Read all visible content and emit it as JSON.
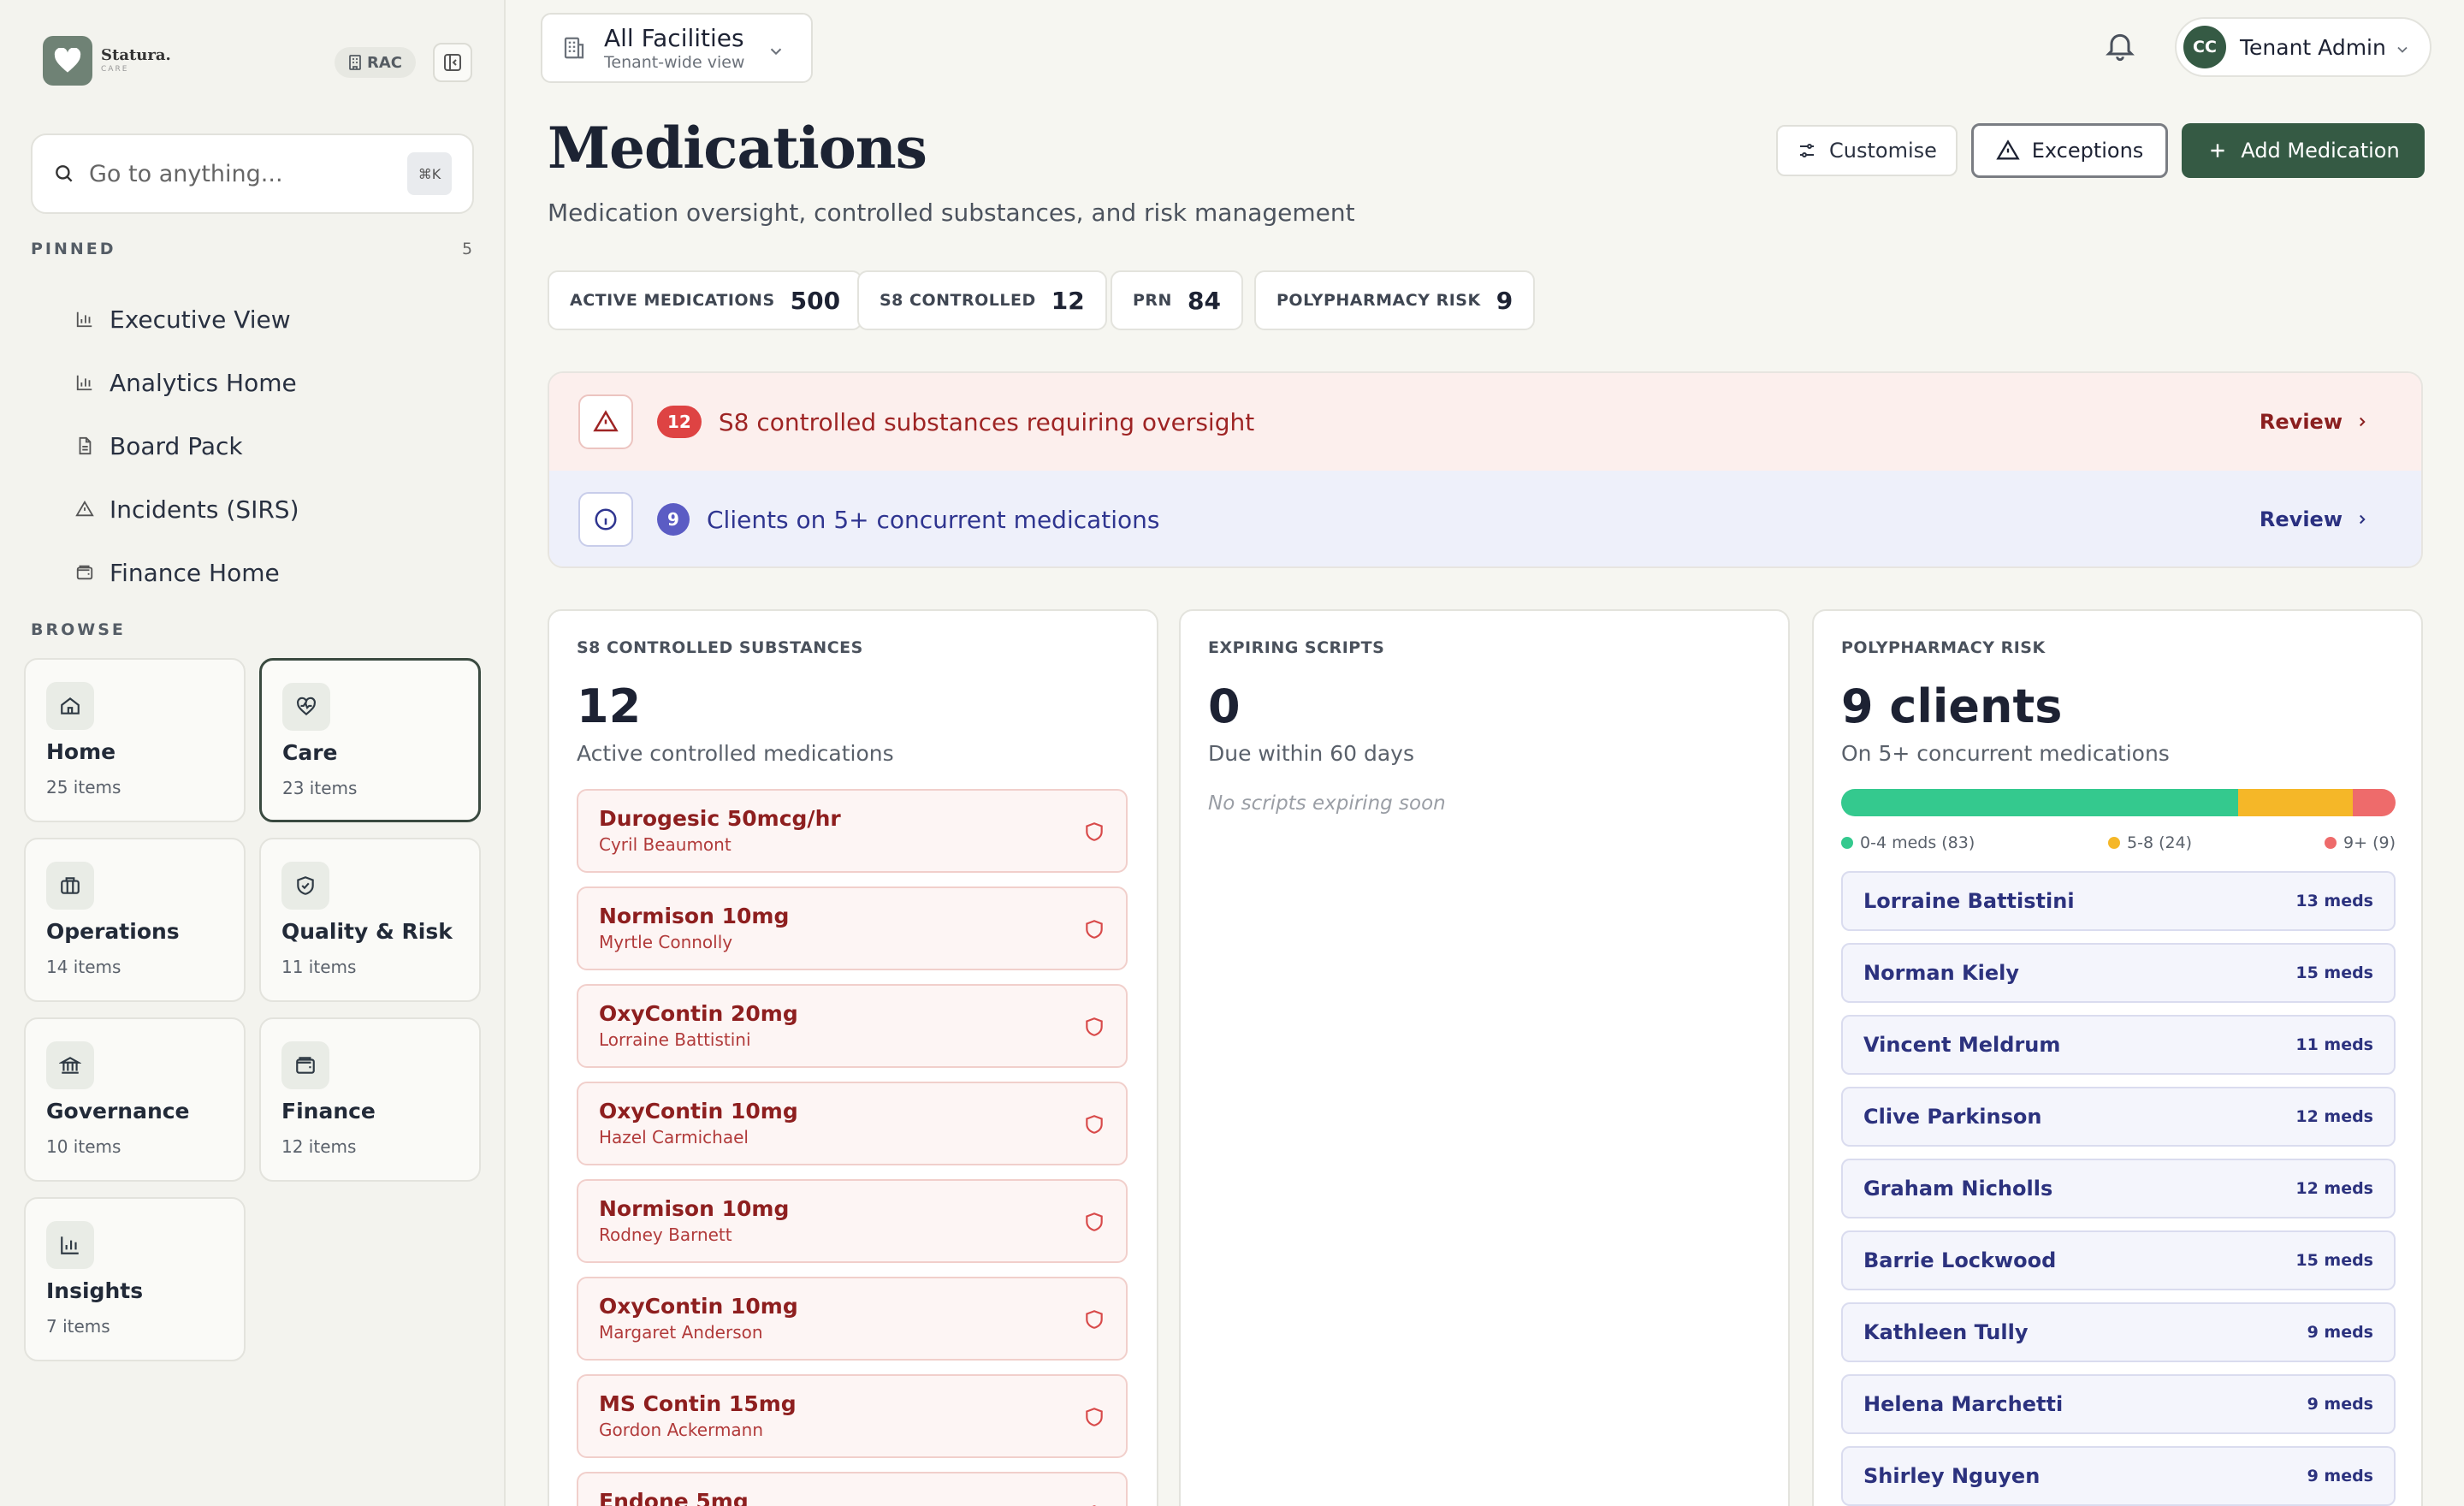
{
  "brand": {
    "name": "Statura.",
    "sub": "CARE"
  },
  "org_badge": "RAC",
  "search": {
    "placeholder": "Go to anything...",
    "shortcut": "⌘K"
  },
  "pinned": {
    "label": "PINNED",
    "count": "5",
    "items": [
      {
        "label": "Executive View",
        "icon": "bar-chart-icon"
      },
      {
        "label": "Analytics Home",
        "icon": "bar-chart-icon"
      },
      {
        "label": "Board Pack",
        "icon": "document-icon"
      },
      {
        "label": "Incidents (SIRS)",
        "icon": "warning-icon"
      },
      {
        "label": "Finance Home",
        "icon": "wallet-icon"
      }
    ]
  },
  "browse": {
    "label": "BROWSE",
    "items": [
      {
        "title": "Home",
        "count": "25 items",
        "icon": "home-icon"
      },
      {
        "title": "Care",
        "count": "23 items",
        "icon": "heart-pulse-icon",
        "active": true
      },
      {
        "title": "Operations",
        "count": "14 items",
        "icon": "briefcase-icon"
      },
      {
        "title": "Quality & Risk",
        "count": "11 items",
        "icon": "shield-check-icon"
      },
      {
        "title": "Governance",
        "count": "10 items",
        "icon": "bank-icon"
      },
      {
        "title": "Finance",
        "count": "12 items",
        "icon": "wallet-icon"
      },
      {
        "title": "Insights",
        "count": "7 items",
        "icon": "bar-chart-icon"
      }
    ]
  },
  "facility": {
    "title": "All Facilities",
    "sub": "Tenant-wide view"
  },
  "user": {
    "initials": "CC",
    "name": "Tenant Admin"
  },
  "page": {
    "title": "Medications",
    "subtitle": "Medication oversight, controlled substances, and risk management"
  },
  "actions": {
    "customise": "Customise",
    "exceptions": "Exceptions",
    "add": "Add Medication"
  },
  "stats": [
    {
      "label": "ACTIVE MEDICATIONS",
      "value": "500"
    },
    {
      "label": "S8 CONTROLLED",
      "value": "12"
    },
    {
      "label": "PRN",
      "value": "84"
    },
    {
      "label": "POLYPHARMACY RISK",
      "value": "9"
    }
  ],
  "alerts": [
    {
      "count": "12",
      "text": "S8 controlled substances requiring oversight",
      "action": "Review"
    },
    {
      "count": "9",
      "text": "Clients on 5+ concurrent medications",
      "action": "Review"
    }
  ],
  "s8_card": {
    "label": "S8 CONTROLLED SUBSTANCES",
    "value": "12",
    "desc": "Active controlled medications",
    "items": [
      {
        "drug": "Durogesic 50mcg/hr",
        "client": "Cyril Beaumont"
      },
      {
        "drug": "Normison 10mg",
        "client": "Myrtle Connolly"
      },
      {
        "drug": "OxyContin 20mg",
        "client": "Lorraine Battistini"
      },
      {
        "drug": "OxyContin 10mg",
        "client": "Hazel Carmichael"
      },
      {
        "drug": "Normison 10mg",
        "client": "Rodney Barnett"
      },
      {
        "drug": "OxyContin 10mg",
        "client": "Margaret Anderson"
      },
      {
        "drug": "MS Contin 15mg",
        "client": "Gordon Ackermann"
      },
      {
        "drug": "Endone 5mg",
        "client": ""
      }
    ]
  },
  "scripts_card": {
    "label": "EXPIRING SCRIPTS",
    "value": "0",
    "desc": "Due within 60 days",
    "empty": "No scripts expiring soon"
  },
  "poly_card": {
    "label": "POLYPHARMACY RISK",
    "value": "9 clients",
    "desc": "On 5+ concurrent medications",
    "distribution": [
      {
        "label": "0-4 meds (83)",
        "count": 83,
        "color": "#34c98e"
      },
      {
        "label": "5-8 (24)",
        "count": 24,
        "color": "#f5b728"
      },
      {
        "label": "9+ (9)",
        "count": 9,
        "color": "#ee6b6b"
      }
    ],
    "clients": [
      {
        "name": "Lorraine Battistini",
        "meds": "13 meds"
      },
      {
        "name": "Norman Kiely",
        "meds": "15 meds"
      },
      {
        "name": "Vincent Meldrum",
        "meds": "11 meds"
      },
      {
        "name": "Clive Parkinson",
        "meds": "12 meds"
      },
      {
        "name": "Graham Nicholls",
        "meds": "12 meds"
      },
      {
        "name": "Barrie Lockwood",
        "meds": "15 meds"
      },
      {
        "name": "Kathleen Tully",
        "meds": "9 meds"
      },
      {
        "name": "Helena Marchetti",
        "meds": "9 meds"
      },
      {
        "name": "Shirley Nguyen",
        "meds": "9 meds"
      }
    ]
  }
}
